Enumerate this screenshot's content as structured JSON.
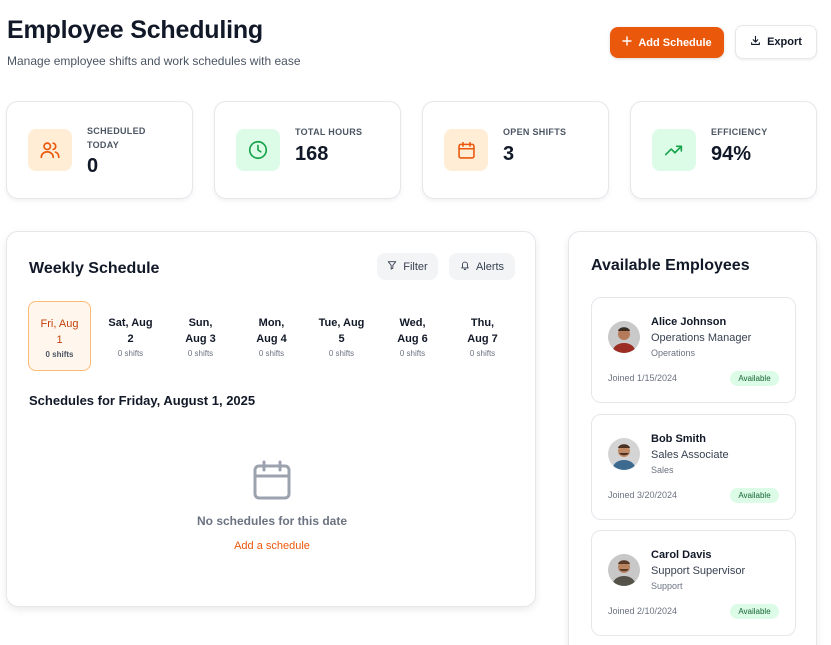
{
  "header": {
    "title": "Employee Scheduling",
    "subtitle": "Manage employee shifts and work schedules with ease",
    "add_label": "Add Schedule",
    "export_label": "Export"
  },
  "stats": [
    {
      "label": "SCHEDULED TODAY",
      "value": "0",
      "icon": "users-icon",
      "color": "#ea580c"
    },
    {
      "label": "TOTAL HOURS",
      "value": "168",
      "icon": "clock-icon",
      "color": "#16a34a"
    },
    {
      "label": "OPEN SHIFTS",
      "value": "3",
      "icon": "calendar-icon",
      "color": "#ea580c"
    },
    {
      "label": "EFFICIENCY",
      "value": "94%",
      "icon": "trending-up-icon",
      "color": "#16a34a"
    }
  ],
  "schedule": {
    "title": "Weekly Schedule",
    "filter_label": "Filter",
    "alerts_label": "Alerts",
    "days": [
      {
        "name": "Fri, Aug 1",
        "shifts": "0 shifts",
        "selected": true
      },
      {
        "name": "Sat, Aug 2",
        "shifts": "0 shifts"
      },
      {
        "name": "Sun, Aug 3",
        "shifts": "0 shifts"
      },
      {
        "name": "Mon, Aug 4",
        "shifts": "0 shifts"
      },
      {
        "name": "Tue, Aug 5",
        "shifts": "0 shifts"
      },
      {
        "name": "Wed, Aug 6",
        "shifts": "0 shifts"
      },
      {
        "name": "Thu, Aug 7",
        "shifts": "0 shifts"
      }
    ],
    "heading": "Schedules for Friday, August 1, 2025",
    "empty_text": "No schedules for this date",
    "add_link": "Add a schedule"
  },
  "employees": {
    "title": "Available Employees",
    "items": [
      {
        "name": "Alice Johnson",
        "role": "Operations Manager",
        "dept": "Operations",
        "joined": "Joined 1/15/2024",
        "status": "Available"
      },
      {
        "name": "Bob Smith",
        "role": "Sales Associate",
        "dept": "Sales",
        "joined": "Joined 3/20/2024",
        "status": "Available"
      },
      {
        "name": "Carol Davis",
        "role": "Support Supervisor",
        "dept": "Support",
        "joined": "Joined 2/10/2024",
        "status": "Available"
      }
    ]
  },
  "colors": {
    "accent": "#ea580c",
    "orange_tint": "#ffedd5",
    "green": "#16a34a",
    "green_tint": "#dcfce7"
  }
}
